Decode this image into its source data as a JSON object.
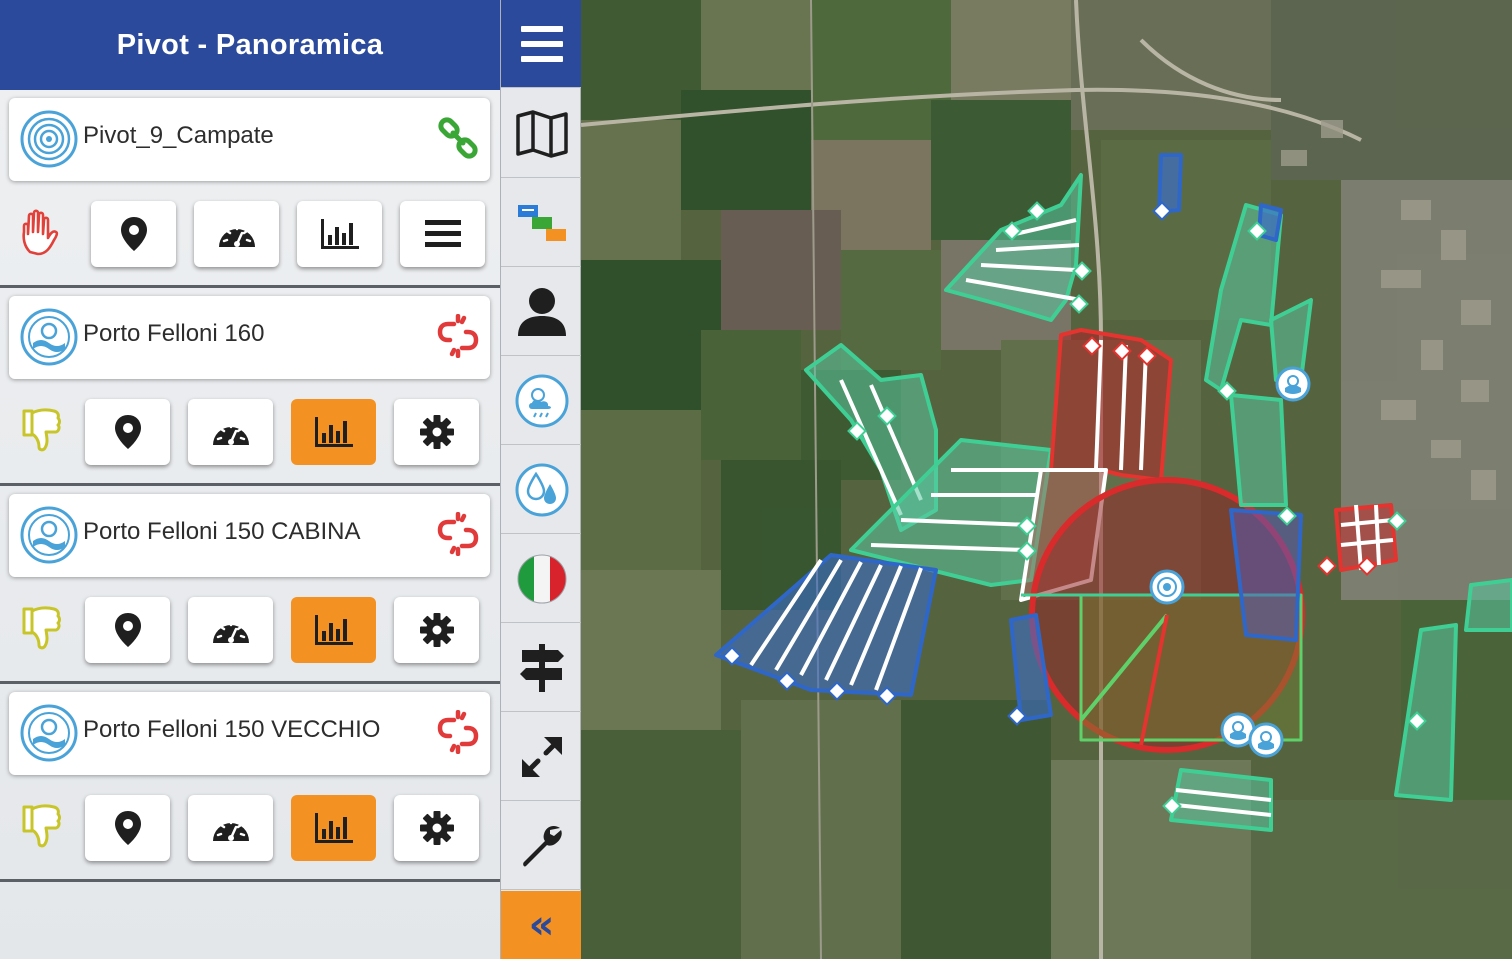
{
  "header": {
    "title": "Pivot - Panoramica"
  },
  "pivots": [
    {
      "name": "Pivot_9_Campate",
      "connection": "connected",
      "status": "stopped",
      "active_tab": "none"
    },
    {
      "name": "Porto Felloni 160",
      "connection": "disconnected",
      "status": "thumbs-down",
      "active_tab": "chart"
    },
    {
      "name": "Porto Felloni 150 CABINA",
      "connection": "disconnected",
      "status": "thumbs-down",
      "active_tab": "chart"
    },
    {
      "name": "Porto Felloni 150 VECCHIO",
      "connection": "disconnected",
      "status": "thumbs-down",
      "active_tab": "chart"
    }
  ],
  "toolbar": {
    "items": [
      "menu-icon",
      "map-icon",
      "legend-icon",
      "user-icon",
      "weather-icon",
      "water-icon",
      "italy-flag-icon",
      "signpost-icon",
      "expand-icon",
      "wrench-icon"
    ],
    "collapse_label": "«"
  },
  "colors": {
    "header_blue": "#2b4a9c",
    "accent_orange": "#f39223",
    "connected_green": "#3aa635",
    "disconnected_red": "#e03a3a",
    "thumb_yellow": "#c8c52a",
    "stop_red": "#e0413a"
  }
}
